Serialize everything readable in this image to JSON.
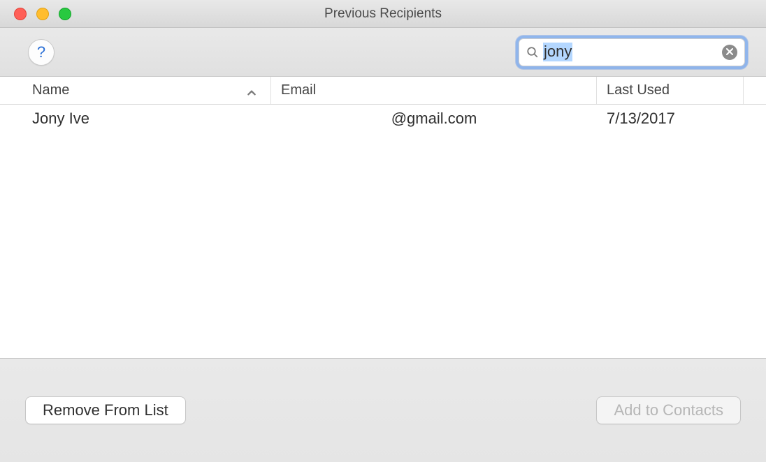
{
  "window": {
    "title": "Previous Recipients"
  },
  "search": {
    "value": "jony"
  },
  "columns": {
    "name": "Name",
    "email": "Email",
    "last_used": "Last Used"
  },
  "rows": [
    {
      "name": "Jony Ive",
      "email": "@gmail.com",
      "last_used": "7/13/2017"
    }
  ],
  "buttons": {
    "remove": "Remove From List",
    "add": "Add to Contacts",
    "help": "?"
  }
}
